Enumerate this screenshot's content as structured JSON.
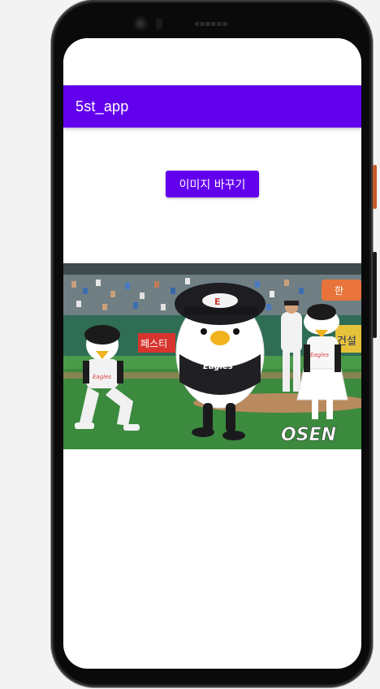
{
  "app": {
    "title": "5st_app"
  },
  "main": {
    "change_image_button_label": "이미지 바꾸기"
  },
  "photo": {
    "ad_sign_text": "페스티",
    "ad_sign_right_text": "건설",
    "sponsor_badge_text": "한",
    "mascot_cap_logo": "E",
    "mascot_shirt_text": "Eagles",
    "watermark_text": "OSEN"
  },
  "colors": {
    "accent": "#6200ee",
    "on_accent": "#ffffff",
    "screen_background": "#ffffff",
    "page_background": "#f3f3f3"
  }
}
